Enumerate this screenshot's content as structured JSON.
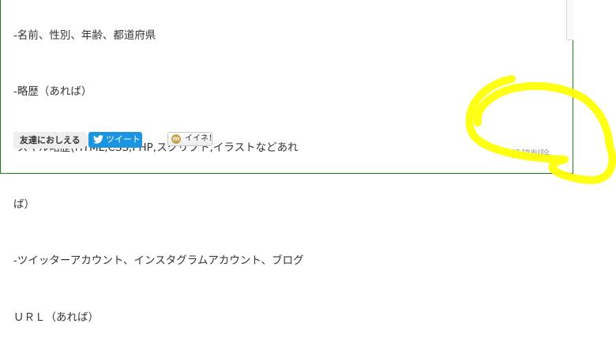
{
  "post": {
    "lines": [
      "-名前、性別、年齢、都道府県",
      "-略歴（あれば）",
      "-スキル略歴(HTML,CSS,PHP,スクリプト,イラストなどあれ",
      "ば）",
      "-ツイッターアカウント、インスタグラムアカウント、ブログ",
      "ＵＲＬ（あれば）"
    ]
  },
  "share": {
    "label": "友達におしえる",
    "tweet_label": "ツイート",
    "tweet_icon": "twitter-bird-icon",
    "iine_label": "イイネ！",
    "iine_icon": "m-logo-icon"
  },
  "actions": {
    "delete_label": "投稿削除"
  },
  "colors": {
    "border": "#1e7d1e",
    "tweet": "#1b95e0",
    "highlight": "#ffff00",
    "delete_text": "#9a9a9a"
  }
}
